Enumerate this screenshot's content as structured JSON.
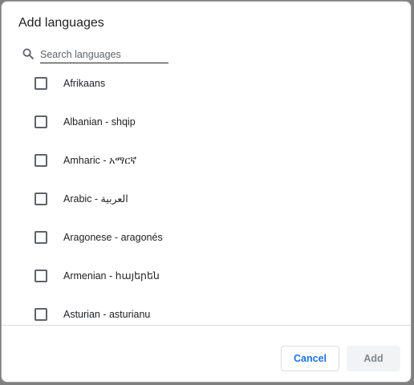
{
  "dialog": {
    "title": "Add languages",
    "search": {
      "placeholder": "Search languages",
      "value": "",
      "icon": "search-icon"
    },
    "languages": [
      {
        "label": "Afrikaans",
        "checked": false
      },
      {
        "label": "Albanian - shqip",
        "checked": false
      },
      {
        "label": "Amharic - አማርኛ",
        "checked": false
      },
      {
        "label": "Arabic - العربية",
        "checked": false
      },
      {
        "label": "Aragonese - aragonés",
        "checked": false
      },
      {
        "label": "Armenian - հայերեն",
        "checked": false
      },
      {
        "label": "Asturian - asturianu",
        "checked": false
      }
    ],
    "buttons": {
      "cancel_label": "Cancel",
      "add_label": "Add",
      "add_enabled": false
    },
    "colors": {
      "accent": "#1a73e8",
      "disabled_text": "#80868b",
      "disabled_bg": "#f1f3f4"
    }
  }
}
